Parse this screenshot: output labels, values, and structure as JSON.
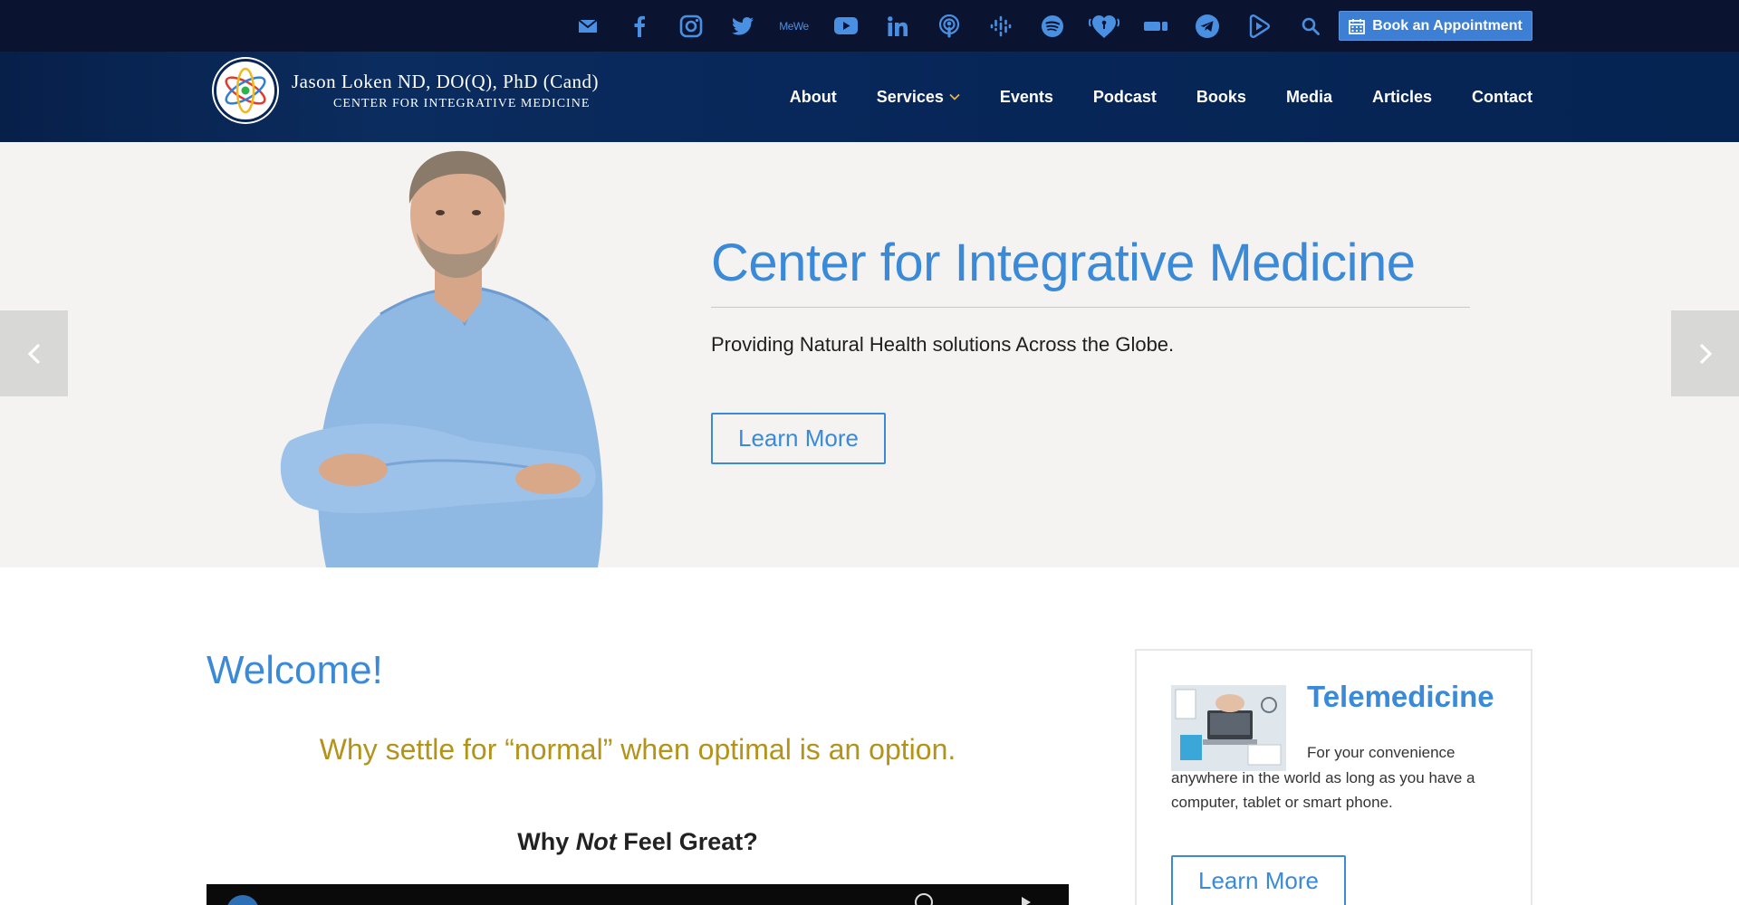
{
  "topbar": {
    "social_icons": [
      "email-icon",
      "facebook-icon",
      "instagram-icon",
      "twitter-icon",
      "mewe-icon",
      "youtube-icon",
      "linkedin-icon",
      "podcasts-icon",
      "google-podcasts-icon",
      "spotify-icon",
      "iheartradio-icon",
      "amazon-music-icon",
      "telegram-icon",
      "rumble-icon",
      "search-icon"
    ],
    "mewe_label": "MeWe",
    "book_button": "Book an Appointment"
  },
  "header": {
    "logo_name": "Jason Loken ND, DO(Q), PhD (Cand)",
    "logo_subtitle": "CENTER FOR INTEGRATIVE MEDICINE",
    "nav": [
      "About",
      "Services",
      "Events",
      "Podcast",
      "Books",
      "Media",
      "Articles",
      "Contact"
    ]
  },
  "hero": {
    "title": "Center for Integrative Medicine",
    "subtitle": "Providing Natural Health solutions Across the Globe.",
    "button": "Learn More"
  },
  "welcome": {
    "title": "Welcome!",
    "tagline": "Why settle for “normal” when optimal is an option.",
    "why_prefix": "Why ",
    "why_em": "Not",
    "why_suffix": " Feel Great?"
  },
  "telemedicine": {
    "title": "Telemedicine",
    "text": "For your convenience anywhere in the world as long as you have a computer, tablet or smart phone.",
    "button": "Learn More"
  },
  "colors": {
    "topbar_bg": "#0a1430",
    "header_bg": "#07204a",
    "accent_blue": "#3a8ad8",
    "gold": "#b3931a",
    "social_icon": "#4a90e2"
  }
}
